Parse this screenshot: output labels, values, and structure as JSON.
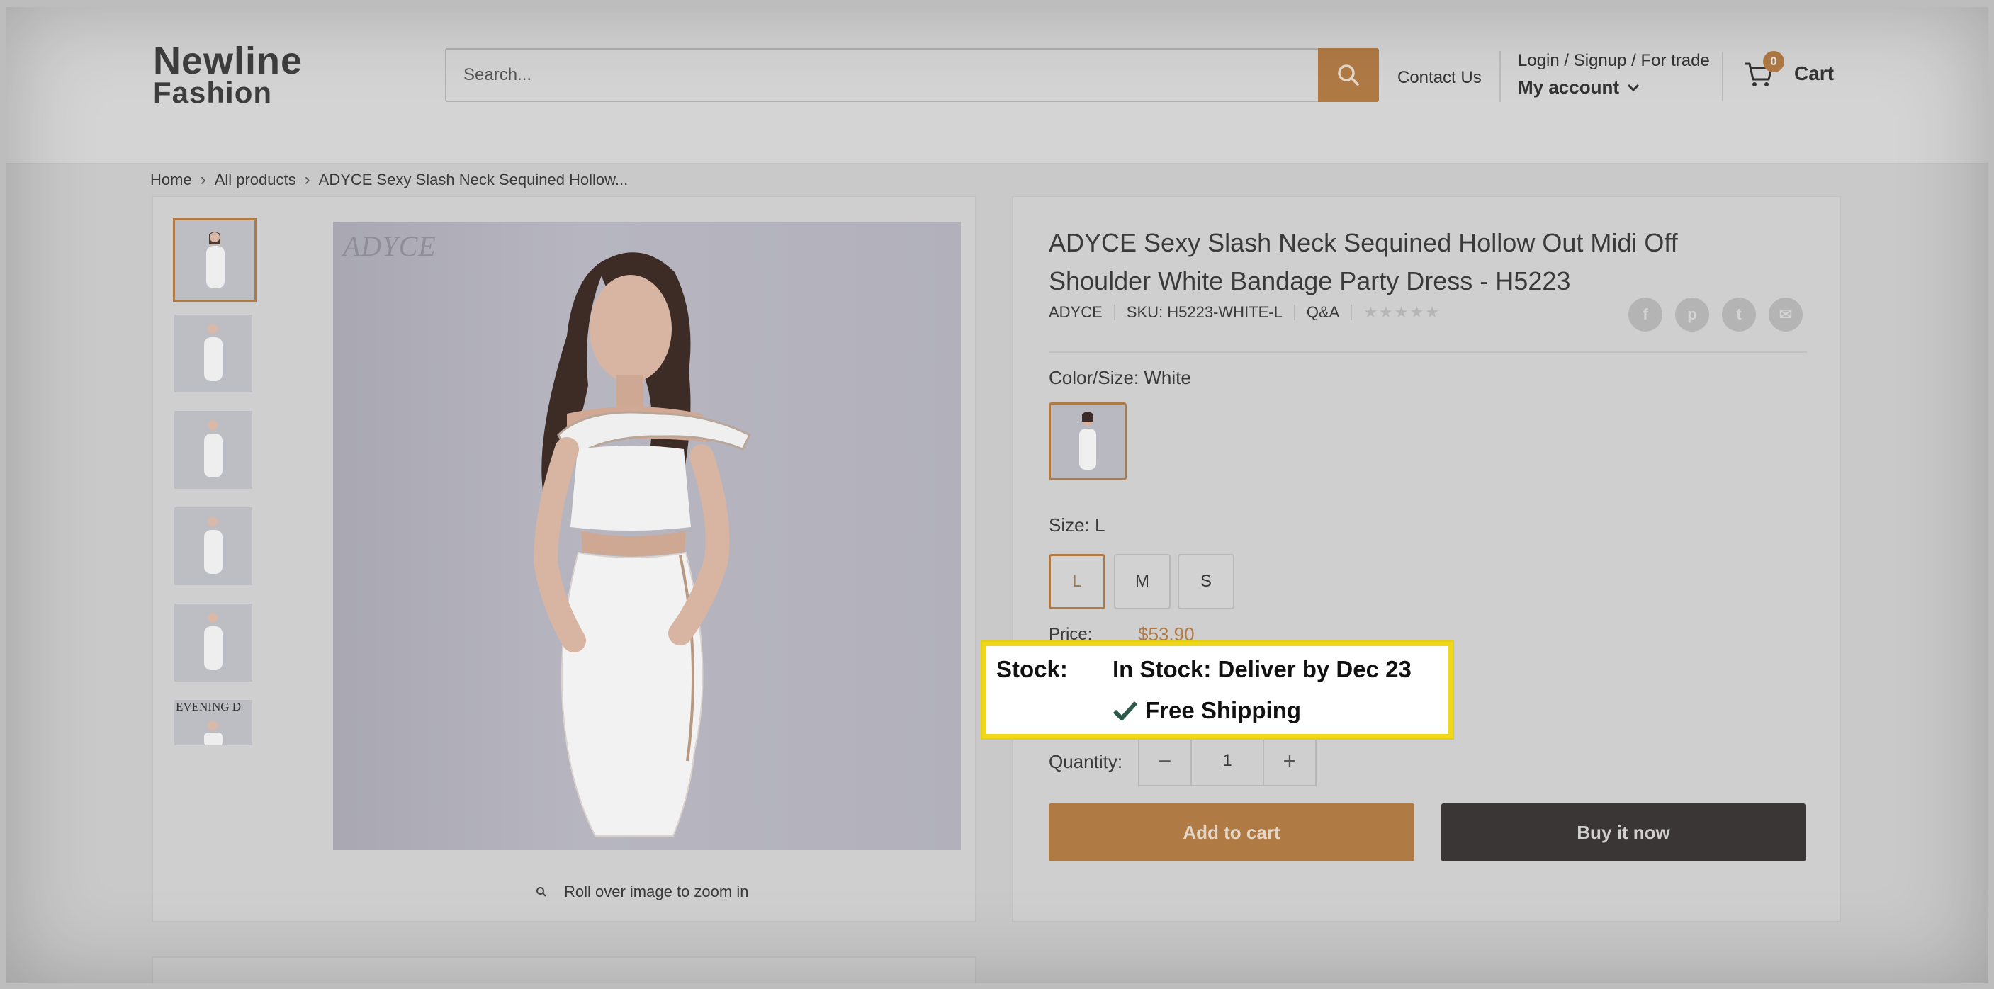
{
  "header": {
    "logo_line1": "Newline",
    "logo_line2": "Fashion",
    "search_placeholder": "Search...",
    "contact": "Contact Us",
    "account_top": "Login / Signup / For trade",
    "account_main": "My account",
    "cart_count": "0",
    "cart_label": "Cart"
  },
  "breadcrumb": {
    "home": "Home",
    "all_products": "All products",
    "current": "ADYCE Sexy Slash Neck Sequined Hollow..."
  },
  "gallery": {
    "image_logo": "ADYCE",
    "thumb_last_text": "EVENING D",
    "zoom_hint": "Roll over image to zoom in"
  },
  "product": {
    "title": "ADYCE Sexy Slash Neck Sequined Hollow Out Midi Off Shoulder White Bandage Party Dress - H5223",
    "vendor": "ADYCE",
    "sku": "SKU: H5223-WHITE-L",
    "qa": "Q&A",
    "stars": "★★★★★",
    "color_label": "Color/Size:",
    "color_value": "White",
    "size_label": "Size:",
    "size_value": "L",
    "sizes": [
      "L",
      "M",
      "S"
    ],
    "price_label": "Price:",
    "price": "$53.90",
    "quantity_label": "Quantity:",
    "quantity": "1",
    "add_to_cart": "Add to cart",
    "buy_now": "Buy it now"
  },
  "share": {
    "facebook": "f",
    "pinterest": "p",
    "twitter": "t",
    "email": "✉"
  },
  "stock_callout": {
    "label": "Stock:",
    "status": "In Stock: Deliver by Dec 23",
    "shipping": "Free Shipping"
  },
  "colors": {
    "accent": "#b07a45",
    "dark_button": "#3b3636",
    "highlight_border": "#f0d91a"
  }
}
